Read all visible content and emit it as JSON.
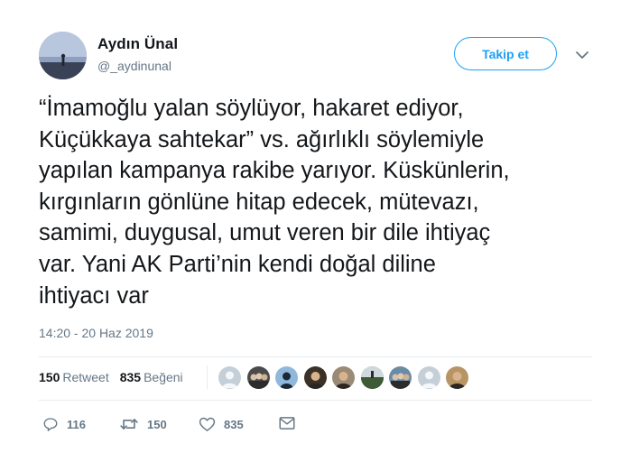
{
  "author": {
    "name": "Aydın Ünal",
    "handle": "@_aydinunal"
  },
  "follow_button": {
    "label": "Takip et"
  },
  "tweet": {
    "lines": [
      "“İmamoğlu yalan söylüyor, hakaret ediyor,",
      "Küçükkaya sahtekar” vs. ağırlıklı söylemiyle",
      "yapılan kampanya rakibe yarıyor. Küskünlerin,",
      "kırgınların gönlüne hitap edecek, mütevazı,",
      "samimi, duygusal, umut veren bir dile ihtiyaç",
      "var. Yani AK Parti’nin kendi doğal diline",
      "ihtiyacı var"
    ],
    "timestamp": "14:20 - 20 Haz 2019"
  },
  "stats": {
    "retweets": {
      "count": "150",
      "label": "Retweet"
    },
    "likes": {
      "count": "835",
      "label": "Beğeni"
    }
  },
  "likers": [
    {
      "color": "#c4cfd8",
      "icon": "default-avatar"
    },
    {
      "color": "#4a4a4a",
      "icon": "group-photo"
    },
    {
      "color": "#8fb8dc",
      "icon": "silhouette"
    },
    {
      "color": "#3b3127",
      "icon": "portrait"
    },
    {
      "color": "#9a8a76",
      "icon": "portrait"
    },
    {
      "color": "#5f7a54",
      "icon": "landscape"
    },
    {
      "color": "#6b8aa6",
      "icon": "group-photo"
    },
    {
      "color": "#c4cfd8",
      "icon": "default-avatar"
    },
    {
      "color": "#b89464",
      "icon": "portrait"
    }
  ],
  "actions": {
    "reply": {
      "count": "116",
      "icon": "reply-icon"
    },
    "retweet": {
      "count": "150",
      "icon": "retweet-icon"
    },
    "like": {
      "count": "835",
      "icon": "heart-icon"
    },
    "message": {
      "icon": "envelope-icon"
    }
  },
  "colors": {
    "accent": "#1da1f2",
    "text": "#14171a",
    "secondary": "#657786",
    "divider": "#e6ecf0"
  }
}
